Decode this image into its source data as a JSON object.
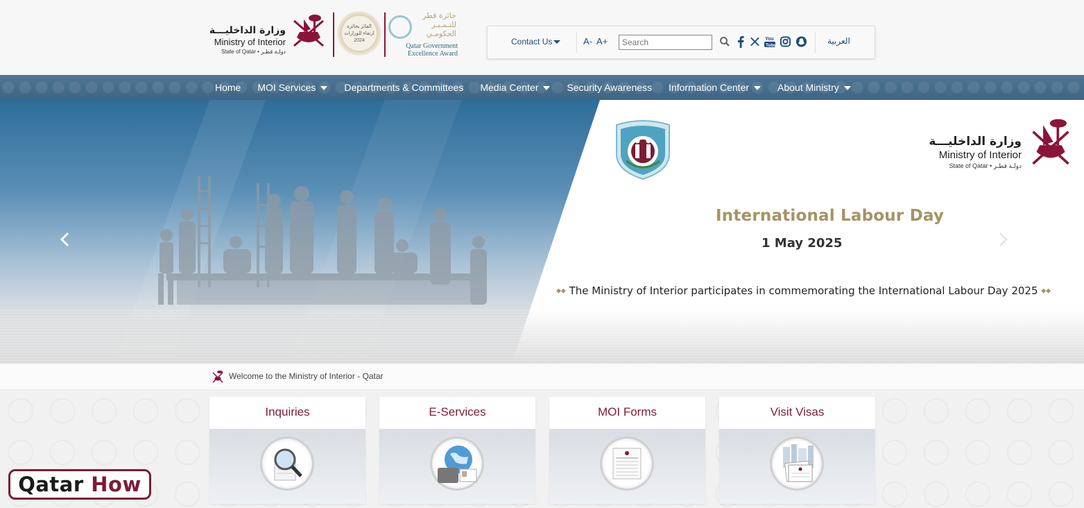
{
  "header": {
    "ministry_ar": "وزارة الداخليـــة",
    "ministry_en": "Ministry of Interior",
    "state": "State of Qatar • دولـة قطـر",
    "award_badge_text": [
      "الفائز بجائزة",
      "ارتقاء للوزارات",
      "2024"
    ],
    "award_ar": [
      "جائزة قطر",
      "للتـمـيـز",
      "الحكومـي"
    ],
    "award_en": [
      "Qatar Government",
      "Excellence Award"
    ],
    "brand_color": "#8a1538"
  },
  "toolbar": {
    "contact_label": "Contact Us",
    "font_decrease": "A-",
    "font_increase": "A+",
    "search_placeholder": "Search",
    "search_value": "",
    "social_icons": [
      "facebook-icon",
      "x-icon",
      "youtube-icon",
      "instagram-icon",
      "snapchat-icon"
    ],
    "language": "العربية"
  },
  "nav": {
    "items": [
      {
        "label": "Home",
        "dropdown": false
      },
      {
        "label": "MOI Services",
        "dropdown": true
      },
      {
        "label": "Departments & Committees",
        "dropdown": false
      },
      {
        "label": "Media Center",
        "dropdown": true
      },
      {
        "label": "Security Awareness",
        "dropdown": false
      },
      {
        "label": "Information Center",
        "dropdown": true
      },
      {
        "label": "About Ministry",
        "dropdown": true
      }
    ]
  },
  "hero": {
    "title": "International Labour Day",
    "date": "1 May 2025",
    "caption": "The Ministry of Interior participates in commemorating the International Labour Day 2025",
    "ministry_ar": "وزارة الداخليـــة",
    "ministry_en": "Ministry of Interior",
    "state": "State of Qatar • دولـة قطـر"
  },
  "welcome": {
    "text": "Welcome to the Ministry of Interior - Qatar"
  },
  "services": [
    {
      "title": "Inquiries",
      "icon": "magnifier-icon"
    },
    {
      "title": "E-Services",
      "icon": "globe-laptop-icon"
    },
    {
      "title": "MOI Forms",
      "icon": "forms-icon"
    },
    {
      "title": "Visit Visas",
      "icon": "visa-documents-icon"
    }
  ],
  "watermark": {
    "part1": "Qatar",
    "part2": "How"
  }
}
